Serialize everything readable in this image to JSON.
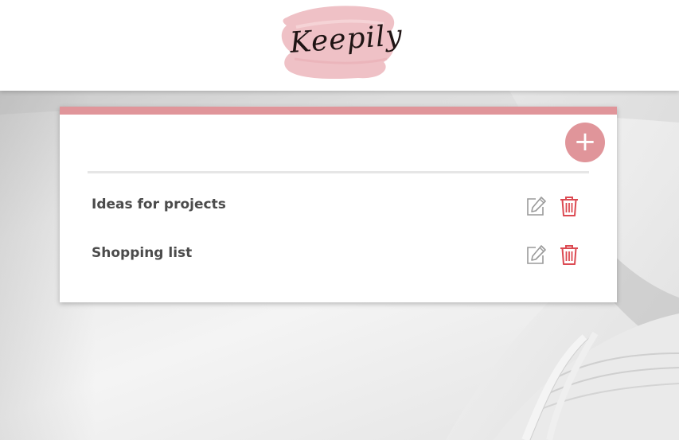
{
  "app": {
    "logo_text": "Keepily"
  },
  "toolbar": {
    "add_symbol": "+"
  },
  "notes": [
    {
      "title": "Ideas for projects"
    },
    {
      "title": "Shopping list"
    }
  ],
  "icons": {
    "add": "plus-icon",
    "edit": "pencil-edit-icon",
    "delete": "trash-icon"
  },
  "colors": {
    "accent": "#e0959a",
    "logo_brush": "#efc1c6",
    "delete_red": "#dc4a52",
    "edit_gray": "#9a9a9a",
    "title_text": "#4b4b4b"
  }
}
